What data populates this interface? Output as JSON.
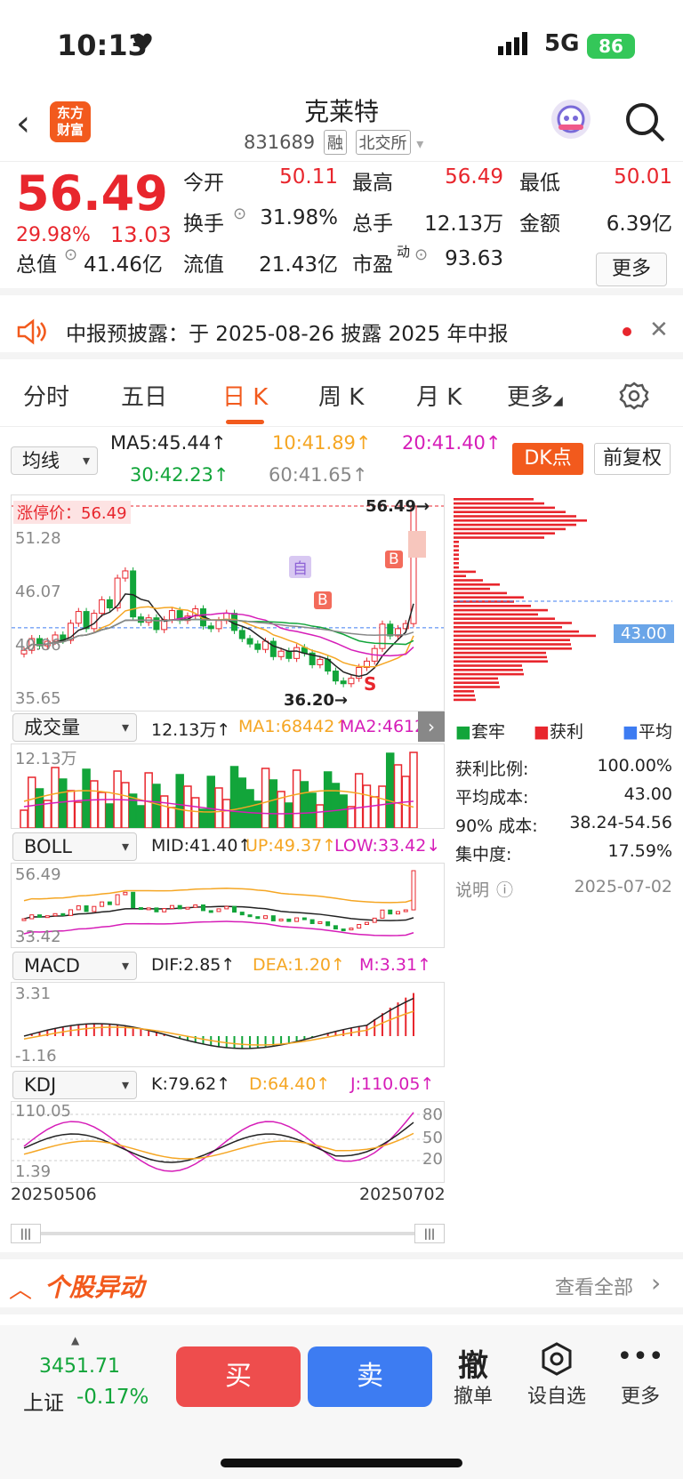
{
  "status_bar": {
    "time": "10:13",
    "network": "5G",
    "battery": "86"
  },
  "header": {
    "logo_line1": "东方",
    "logo_line2": "财富",
    "stock_name": "克莱特",
    "stock_code": "831689",
    "tag_margin": "融",
    "tag_exchange": "北交所"
  },
  "quote": {
    "price": "56.49",
    "change_pct": "29.98%",
    "change": "13.03",
    "open_label": "今开",
    "open": "50.11",
    "high_label": "最高",
    "high": "56.49",
    "low_label": "最低",
    "low": "50.01",
    "turnover_label": "换手",
    "turnover": "31.98%",
    "volume_label": "总手",
    "volume": "12.13万",
    "amount_label": "金额",
    "amount": "6.39亿",
    "mktcap_label": "总值",
    "mktcap": "41.46亿",
    "float_label": "流值",
    "float": "21.43亿",
    "pe_label": "市盈",
    "pe_sup": "动",
    "pe": "93.63",
    "more": "更多"
  },
  "notice": {
    "text": "中报预披露：于 2025-08-26 披露 2025 年中报"
  },
  "tabs": [
    "分时",
    "五日",
    "日 K",
    "周 K",
    "月 K",
    "更多"
  ],
  "ma_row": {
    "select": "均线",
    "ma5": "MA5:45.44↑",
    "ma10": "10:41.89↑",
    "ma20": "20:41.40↑",
    "ma30": "30:42.23↑",
    "ma60": "60:41.65↑",
    "dk": "DK点",
    "adjust": "前复权"
  },
  "kline": {
    "limit_up_label": "涨停价：56.49",
    "y_top": "56.49",
    "y1": "51.28",
    "y2": "46.07",
    "y3": "40.86",
    "y4": "35.65",
    "max_mark": "56.49→",
    "min_mark": "36.20→",
    "self_mark": "自",
    "b_mark": "B",
    "s_mark": "S",
    "chip_cost": "43.00"
  },
  "volume_bar": {
    "select": "成交量",
    "vol": "12.13万↑",
    "ma1": "MA1:68442↑",
    "ma2": "MA2:46120↑",
    "ymax": "12.13万"
  },
  "boll_bar": {
    "select": "BOLL",
    "mid": "MID:41.40↑",
    "up": "UP:49.37↑",
    "low": "LOW:33.42↓",
    "ymax": "56.49",
    "ymin": "33.42"
  },
  "macd_bar": {
    "select": "MACD",
    "dif": "DIF:2.85↑",
    "dea": "DEA:1.20↑",
    "m": "M:3.31↑",
    "ymax": "3.31",
    "ymin": "-1.16"
  },
  "kdj_bar": {
    "select": "KDJ",
    "k": "K:79.62↑",
    "d": "D:64.40↑",
    "j": "J:110.05↑",
    "ymax": "110.05",
    "ymin": "1.39",
    "l80": "80",
    "l50": "50",
    "l20": "20"
  },
  "date_range": {
    "start": "20250506",
    "end": "20250702"
  },
  "chip": {
    "legend_trapped": "套牢",
    "legend_profit": "获利",
    "legend_avg": "平均",
    "rows": [
      {
        "label": "获利比例:",
        "value": "100.00%"
      },
      {
        "label": "平均成本:",
        "value": "43.00"
      },
      {
        "label": "90% 成本:",
        "value": "38.24-54.56"
      },
      {
        "label": "集中度:",
        "value": "17.59%"
      }
    ],
    "note_label": "说明",
    "date": "2025-07-02"
  },
  "yidong": {
    "title": "个股异动",
    "view_all": "查看全部"
  },
  "bottom": {
    "index_value": "3451.71",
    "index_name": "上证",
    "index_change": "-0.17%",
    "buy": "买",
    "sell": "卖",
    "cancel_icon": "撤",
    "cancel": "撤单",
    "add_watch": "设自选",
    "more": "更多"
  },
  "colors": {
    "up": "#e8262d",
    "down": "#12a53a",
    "brand": "#f25a1d",
    "sell": "#3d7cf2"
  }
}
